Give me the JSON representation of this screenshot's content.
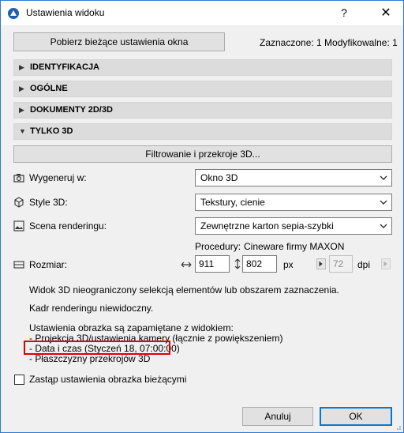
{
  "window": {
    "title": "Ustawienia widoku",
    "help": "?",
    "close": "✕"
  },
  "toolbar": {
    "fetch_button": "Pobierz bieżące ustawienia okna",
    "selection_info": "Zaznaczone: 1 Modyfikowalne: 1"
  },
  "sections": [
    {
      "label": "IDENTYFIKACJA",
      "expanded": false
    },
    {
      "label": "OGÓLNE",
      "expanded": false
    },
    {
      "label": "DOKUMENTY 2D/3D",
      "expanded": false
    },
    {
      "label": "TYLKO 3D",
      "expanded": true
    }
  ],
  "only3d": {
    "filter_button": "Filtrowanie i przekroje 3D...",
    "generate_label": "Wygeneruj w:",
    "generate_value": "Okno 3D",
    "style_label": "Style 3D:",
    "style_value": "Tekstury, cienie",
    "scene_label": "Scena renderingu:",
    "scene_value": "Zewnętrzne karton sepia-szybki",
    "procedure_label": "Procedury:",
    "procedure_value": "Cineware firmy MAXON",
    "size_label": "Rozmiar:",
    "width": "911",
    "height": "802",
    "unit": "px",
    "dpi_value": "72",
    "dpi_unit": "dpi",
    "info_line1": "Widok 3D nieograniczony selekcją elementów lub obszarem zaznaczenia.",
    "info_line2": "Kadr renderingu niewidoczny.",
    "info_line3": "Ustawienia obrazka są zapamiętane z widokiem:",
    "info_line4": "- Projekcja 3D/ustawienia kamery (łącznie z powiększeniem)",
    "info_line5": "- Data i czas (Styczeń 18, 07:00:00)",
    "info_line6": "- Płaszczyzny przekrojów 3D",
    "replace_checkbox_label": "Zastąp ustawienia obrazka bieżącymi",
    "replace_checked": false
  },
  "footer": {
    "cancel": "Anuluj",
    "ok": "OK"
  },
  "colors": {
    "accent": "#0078d7",
    "highlight": "#e00000"
  }
}
